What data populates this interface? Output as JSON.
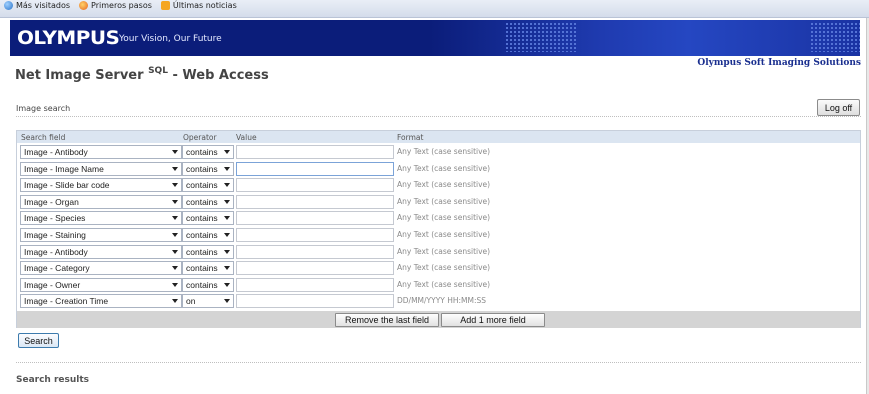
{
  "bookmarks": [
    {
      "label": "Más visitados",
      "icon": "globe-icon"
    },
    {
      "label": "Primeros pasos",
      "icon": "firefox-icon"
    },
    {
      "label": "Últimas noticias",
      "icon": "rss-icon"
    }
  ],
  "banner": {
    "logo": "OLYMPUS",
    "tagline": "Your Vision, Our Future"
  },
  "header": {
    "company": "Olympus Soft Imaging Solutions",
    "title": "Net Image Server",
    "title_sup": "SQL",
    "title_suffix": " - Web Access"
  },
  "section": {
    "label": "Image search",
    "logoff_label": "Log off"
  },
  "search_table": {
    "headers": {
      "field": "Search field",
      "operator": "Operator",
      "value": "Value",
      "format": "Format"
    },
    "rows": [
      {
        "field": "Image - Antibody",
        "operator": "contains",
        "value": "",
        "format": "Any Text (case sensitive)"
      },
      {
        "field": "Image - Image Name",
        "operator": "contains",
        "value": "",
        "format": "Any Text (case sensitive)"
      },
      {
        "field": "Image - Slide bar code",
        "operator": "contains",
        "value": "",
        "format": "Any Text (case sensitive)"
      },
      {
        "field": "Image - Organ",
        "operator": "contains",
        "value": "",
        "format": "Any Text (case sensitive)"
      },
      {
        "field": "Image - Species",
        "operator": "contains",
        "value": "",
        "format": "Any Text (case sensitive)"
      },
      {
        "field": "Image - Staining",
        "operator": "contains",
        "value": "",
        "format": "Any Text (case sensitive)"
      },
      {
        "field": "Image - Antibody",
        "operator": "contains",
        "value": "",
        "format": "Any Text (case sensitive)"
      },
      {
        "field": "Image - Category",
        "operator": "contains",
        "value": "",
        "format": "Any Text (case sensitive)"
      },
      {
        "field": "Image - Owner",
        "operator": "contains",
        "value": "",
        "format": "Any Text (case sensitive)"
      },
      {
        "field": "Image - Creation Time",
        "operator": "on",
        "value": "",
        "format": "DD/MM/YYYY HH:MM:SS"
      }
    ],
    "remove_label": "Remove the last field",
    "add_label": "Add 1 more field"
  },
  "search_label": "Search",
  "results_label": "Search results",
  "colors": {
    "banner": "#0b1d7a",
    "company_text": "#1a2f8f",
    "table_header": "#dbe5f1",
    "table_footer": "#d4d4d4"
  }
}
